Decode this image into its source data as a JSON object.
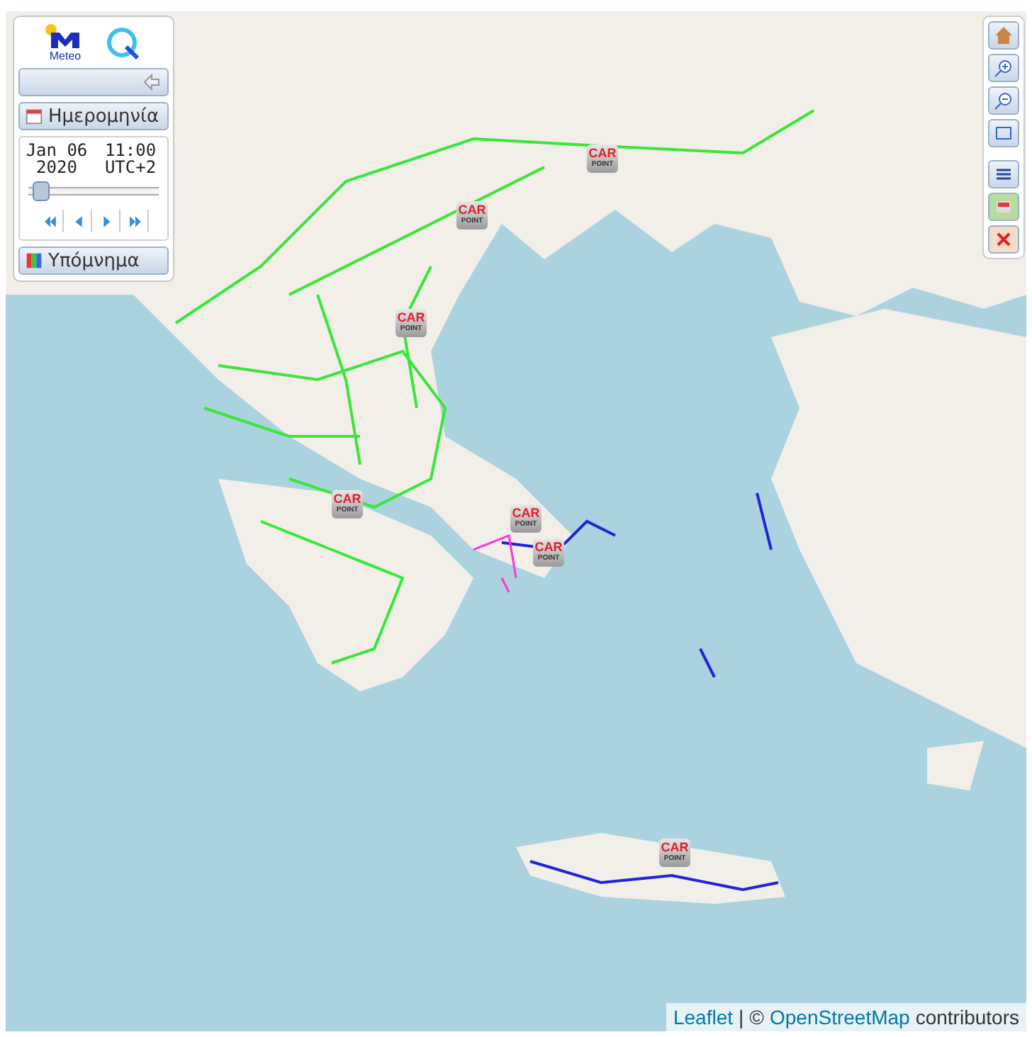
{
  "panel": {
    "logo_text": "Meteo",
    "date_button": "Ημερομηνία",
    "date": "Jan 06 2020",
    "time": "11:00 UTC+2",
    "slider": {
      "level": 0.03
    },
    "legend_button": "Υπόμνημα"
  },
  "markers": [
    {
      "line1": "CAR",
      "line2": "POINT"
    },
    {
      "line1": "CAR",
      "line2": "POINT"
    },
    {
      "line1": "CAR",
      "line2": "POINT"
    },
    {
      "line1": "CAR",
      "line2": "POINT"
    },
    {
      "line1": "CAR",
      "line2": "POINT"
    },
    {
      "line1": "CAR",
      "line2": "POINT"
    },
    {
      "line1": "CAR",
      "line2": "POINT"
    }
  ],
  "attribution": {
    "link1": "Leaflet",
    "separator": "|",
    "copyright": "©",
    "link2": "OpenStreetMap",
    "text": "contributors"
  }
}
